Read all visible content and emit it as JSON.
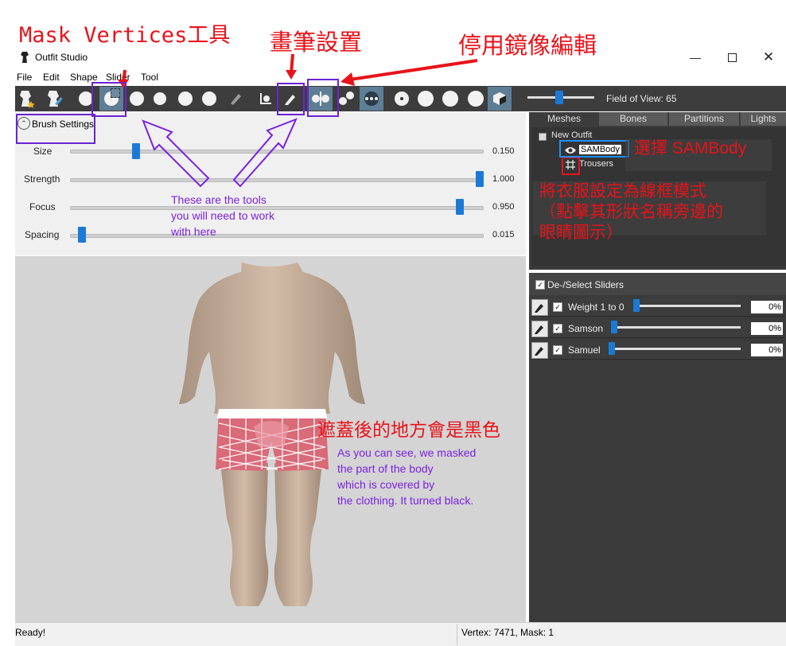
{
  "window": {
    "title": "Outfit Studio"
  },
  "menu": [
    "File",
    "Edit",
    "Shape",
    "Slider",
    "Tool"
  ],
  "toolbar": {
    "fov_label": "Field of View: 65",
    "fov_value": 65
  },
  "brush_settings": {
    "title": "Brush Settings",
    "sliders": [
      {
        "label": "Size",
        "value": "0.150",
        "pos": 0.15
      },
      {
        "label": "Strength",
        "value": "1.000",
        "pos": 1.0
      },
      {
        "label": "Focus",
        "value": "0.950",
        "pos": 0.95
      },
      {
        "label": "Spacing",
        "value": "0.015",
        "pos": 0.015
      }
    ]
  },
  "right_tabs": [
    "Meshes",
    "Bones",
    "Partitions",
    "Lights"
  ],
  "tree": {
    "root": "New Outfit",
    "items": [
      "SAMBody",
      "Trousers"
    ]
  },
  "sliders_panel": {
    "header": "De-/Select Sliders",
    "rows": [
      {
        "label": "Weight 1 to 0",
        "pct": "0%",
        "pos": 0.0
      },
      {
        "label": "Samson",
        "pct": "0%",
        "pos": 0.0
      },
      {
        "label": "Samuel",
        "pct": "0%",
        "pos": 0.0
      }
    ]
  },
  "status": {
    "left": "Ready!",
    "right": "Vertex: 7471, Mask: 1"
  },
  "annotations": {
    "mask_vertices": "Mask Vertices工具",
    "brush_settings_cn": "畫筆設置",
    "disable_mirror": "停用鏡像編輯",
    "select_sambody": "選擇 SAMBody",
    "wireframe_note": [
      "將衣服設定為線框模式",
      "（點擊其形狀名稱旁邊的",
      "眼睛圖示）"
    ],
    "masked_black": "遮蓋後的地方會是黑色",
    "tools_note": [
      "These are the tools",
      "you will need to work",
      "with here"
    ],
    "masked_note": [
      "As you can see, we masked",
      "the part of the body",
      "which is covered by",
      "the clothing. It turned black."
    ]
  },
  "colors": {
    "accent": "#1c7ad6",
    "annotation_red": "#e8131a",
    "annotation_purple": "#7a22e0"
  }
}
